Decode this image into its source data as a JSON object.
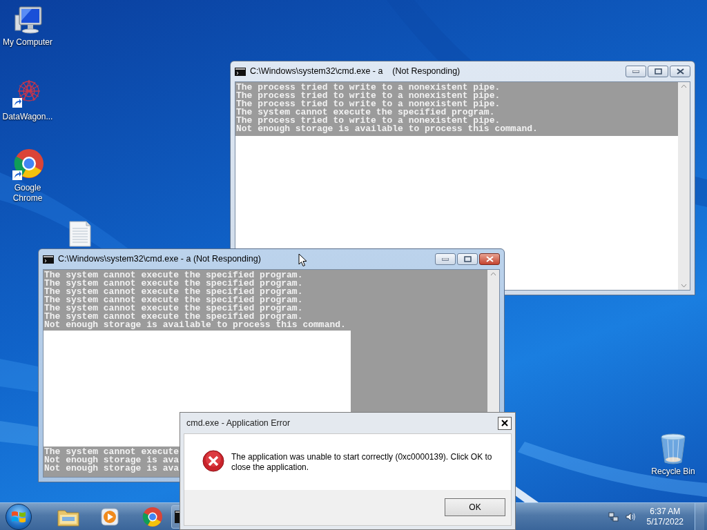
{
  "desktop_icons": [
    {
      "kind": "computer",
      "label": "My Computer"
    },
    {
      "kind": "app_shortcut",
      "label": "DataWagon..."
    },
    {
      "kind": "chrome_shortcut",
      "label": "Google Chrome"
    },
    {
      "kind": "document"
    },
    {
      "kind": "recycle_bin",
      "label": "Recycle Bin"
    }
  ],
  "windows": [
    {
      "kind": "partial_repaint",
      "active": false,
      "title": "C:\\Windows\\system32\\cmd.exe - a    (Not Responding)",
      "lines": [
        "The process tried to write to a nonexistent pipe.",
        "The process tried to write to a nonexistent pipe.",
        "The process tried to write to a nonexistent pipe.",
        "The system cannot execute the specified program.",
        "The process tried to write to a nonexistent pipe.",
        "Not enough storage is available to process this command."
      ]
    },
    {
      "kind": "glitch_block",
      "active": true,
      "title": "C:\\Windows\\system32\\cmd.exe - a (Not Responding)",
      "lines": [
        "The system cannot execute the specified program.",
        "The system cannot execute the specified program.",
        "The system cannot execute the specified program.",
        "The system cannot execute the specified program.",
        "The system cannot execute the specified program.",
        "The system cannot execute the specified program.",
        "Not enough storage is available to process this command."
      ],
      "bottom_lines": [
        "The system cannot execute",
        "Not enough storage is ava",
        "Not enough storage is ava"
      ]
    }
  ],
  "dialog": {
    "title": "cmd.exe - Application Error",
    "message": "The application was unable to start correctly (0xc0000139). Click OK to close the application.",
    "button": "OK"
  },
  "taskbar": {
    "items": [
      {
        "kind": "explorer"
      },
      {
        "kind": "media_player"
      },
      {
        "kind": "chrome"
      },
      {
        "kind": "console"
      }
    ],
    "time": "6:37 AM",
    "date": "5/17/2022"
  }
}
